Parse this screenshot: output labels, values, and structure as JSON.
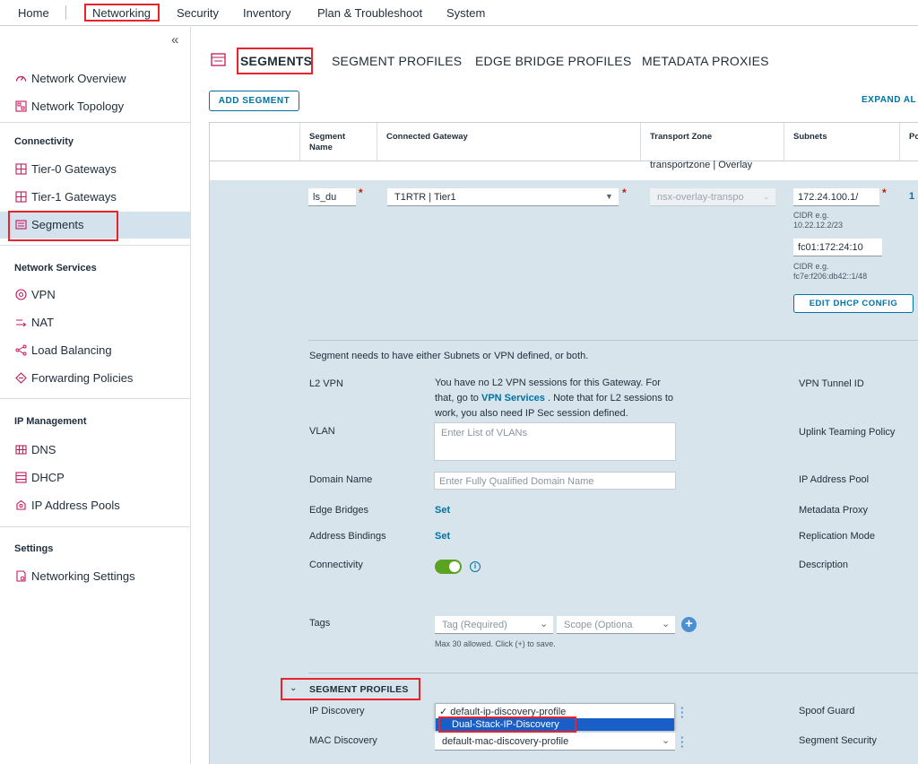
{
  "topnav": {
    "items": [
      "Home",
      "Networking",
      "Security",
      "Inventory",
      "Plan & Troubleshoot",
      "System"
    ]
  },
  "sidebar": {
    "collapse_glyph": "«",
    "items": {
      "network_overview": "Network Overview",
      "network_topology": "Network Topology",
      "connectivity": "Connectivity",
      "tier0": "Tier-0 Gateways",
      "tier1": "Tier-1 Gateways",
      "segments": "Segments",
      "network_services": "Network Services",
      "vpn": "VPN",
      "nat": "NAT",
      "load_balancing": "Load Balancing",
      "forwarding_policies": "Forwarding Policies",
      "ip_management": "IP Management",
      "dns": "DNS",
      "dhcp": "DHCP",
      "ip_address_pools": "IP Address Pools",
      "settings": "Settings",
      "networking_settings": "Networking Settings"
    }
  },
  "tabs": [
    "SEGMENTS",
    "SEGMENT PROFILES",
    "EDGE BRIDGE PROFILES",
    "METADATA PROXIES"
  ],
  "toolbar": {
    "add_segment": "ADD SEGMENT",
    "expand_all": "EXPAND AL"
  },
  "table": {
    "headers": {
      "segment_name": "Segment Name",
      "connected_gateway": "Connected Gateway",
      "transport_zone": "Transport Zone",
      "subnets": "Subnets",
      "ports": "Po"
    },
    "prev_row_transport": "transportzone | Overlay"
  },
  "form": {
    "segment_name_value": "ls_du",
    "gateway_value": "T1RTR | Tier1",
    "transport_zone_value": "nsx-overlay-transpo",
    "subnet_v4": "172.24.100.1/",
    "cidr_hint_v4": "CIDR e.g. 10.22.12.2/23",
    "subnet_v6": "fc01:172:24:10",
    "cidr_hint_v6": "CIDR e.g. fc7e:f206:db42::1/48",
    "ports_count": "1",
    "edit_dhcp": "EDIT DHCP CONFIG",
    "notice": "Segment needs to have either Subnets or VPN defined, or both.",
    "l2vpn_label": "L2 VPN",
    "l2vpn_msg_1": "You have no L2 VPN sessions for this Gateway. For",
    "l2vpn_msg_2a": "that, go to ",
    "l2vpn_msg_link": "VPN Services",
    "l2vpn_msg_2b": " . Note that for L2 sessions to",
    "l2vpn_msg_3": "work, you also need IP Sec session defined.",
    "vpn_tunnel_id": "VPN Tunnel ID",
    "vlan_label": "VLAN",
    "vlan_placeholder": "Enter List of VLANs",
    "uplink_teaming": "Uplink Teaming Policy",
    "domain_label": "Domain Name",
    "domain_placeholder": "Enter Fully Qualified Domain Name",
    "ip_address_pool": "IP Address Pool",
    "edge_bridges": "Edge Bridges",
    "set": "Set",
    "metadata_proxy": "Metadata Proxy",
    "address_bindings": "Address Bindings",
    "replication_mode": "Replication Mode",
    "connectivity": "Connectivity",
    "connectivity_on": true,
    "description": "Description",
    "tags_label": "Tags",
    "tag_placeholder": "Tag (Required)",
    "scope_placeholder": "Scope (Optiona",
    "tags_hint": "Max 30 allowed. Click (+) to save."
  },
  "segment_profiles": {
    "heading": "SEGMENT PROFILES",
    "ip_discovery": "IP Discovery",
    "ip_discovery_options": [
      "default-ip-discovery-profile",
      "Dual-Stack-IP-Discovery"
    ],
    "ip_discovery_checked_index": 0,
    "ip_discovery_highlight_index": 1,
    "check_glyph": "✓",
    "spoof_guard": "Spoof Guard",
    "mac_discovery": "MAC Discovery",
    "mac_discovery_value": "default-mac-discovery-profile",
    "segment_security": "Segment Security"
  },
  "colors": {
    "accent": "#0072a3",
    "highlight": "#e8232c",
    "expanded_bg": "#d7e4ec",
    "toggle_on": "#5aa220"
  }
}
